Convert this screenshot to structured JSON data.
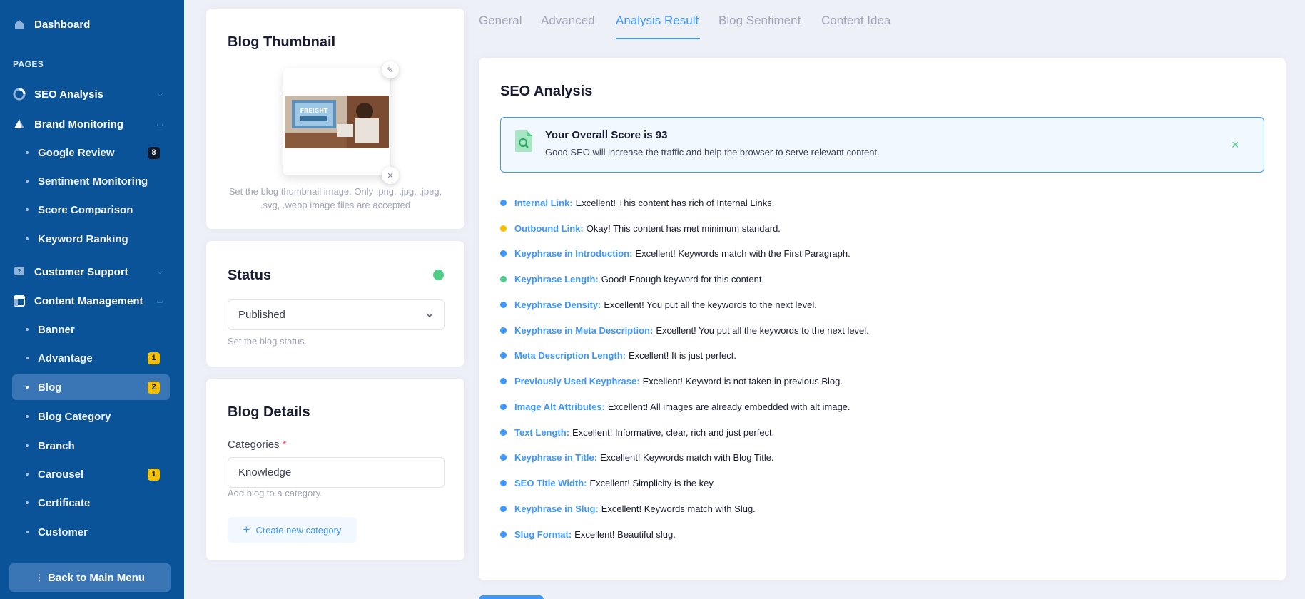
{
  "sidebar": {
    "dashboard": "Dashboard",
    "pages_label": "PAGES",
    "seo_analysis": "SEO Analysis",
    "brand_monitoring": "Brand Monitoring",
    "brand_items": [
      {
        "label": "Google Review",
        "badge": "8"
      },
      {
        "label": "Sentiment Monitoring"
      },
      {
        "label": "Score Comparison"
      },
      {
        "label": "Keyword Ranking"
      }
    ],
    "customer_support": "Customer Support",
    "content_management": "Content Management",
    "content_items": [
      {
        "label": "Banner"
      },
      {
        "label": "Advantage",
        "badge": "1"
      },
      {
        "label": "Blog",
        "badge": "2"
      },
      {
        "label": "Blog Category"
      },
      {
        "label": "Branch"
      },
      {
        "label": "Carousel",
        "badge": "1"
      },
      {
        "label": "Certificate"
      },
      {
        "label": "Customer"
      }
    ],
    "back_button": "Back to Main Menu"
  },
  "thumbnail": {
    "title": "Blog Thumbnail",
    "hint": "Set the blog thumbnail image. Only .png, .jpg, .jpeg, .svg, .webp image files are accepted",
    "image_text": "FREIGHT"
  },
  "status": {
    "title": "Status",
    "value": "Published",
    "hint": "Set the blog status.",
    "indicator_color": "#50cd89"
  },
  "details": {
    "title": "Blog Details",
    "categories_label": "Categories",
    "required_mark": "*",
    "categories_value": "Knowledge",
    "categories_hint": "Add blog to a category.",
    "create_button": "Create new category"
  },
  "tabs": [
    {
      "label": "General"
    },
    {
      "label": "Advanced"
    },
    {
      "label": "Analysis Result",
      "active": true
    },
    {
      "label": "Blog Sentiment"
    },
    {
      "label": "Content Idea"
    }
  ],
  "seo": {
    "title": "SEO Analysis",
    "score_title": "Your Overall Score is 93",
    "score_sub": "Good SEO will increase the traffic and help the browser to serve relevant content.",
    "checks": [
      {
        "key": "Internal Link:",
        "text": "Excellent! This content has rich of Internal Links.",
        "color": "#3e97ff"
      },
      {
        "key": "Outbound Link:",
        "text": "Okay! This content has met minimum standard.",
        "color": "#f6c000"
      },
      {
        "key": "Keyphrase in Introduction:",
        "text": "Excellent! Keywords match with the First Paragraph.",
        "color": "#3e97ff"
      },
      {
        "key": "Keyphrase Length:",
        "text": "Good! Enough keyword for this content.",
        "color": "#50cd89"
      },
      {
        "key": "Keyphrase Density:",
        "text": "Excellent! You put all the keywords to the next level.",
        "color": "#3e97ff"
      },
      {
        "key": "Keyphrase in Meta Description:",
        "text": "Excellent! You put all the keywords to the next level.",
        "color": "#3e97ff"
      },
      {
        "key": "Meta Description Length:",
        "text": "Excellent! It is just perfect.",
        "color": "#3e97ff"
      },
      {
        "key": "Previously Used Keyphrase:",
        "text": "Excellent! Keyword is not taken in previous Blog.",
        "color": "#3e97ff"
      },
      {
        "key": "Image Alt Attributes:",
        "text": "Excellent! All images are already embedded with alt image.",
        "color": "#3e97ff"
      },
      {
        "key": "Text Length:",
        "text": "Excellent! Informative, clear, rich and just perfect.",
        "color": "#3e97ff"
      },
      {
        "key": "Keyphrase in Title:",
        "text": "Excellent! Keywords match with Blog Title.",
        "color": "#3e97ff"
      },
      {
        "key": "SEO Title Width:",
        "text": "Excellent! Simplicity is the key.",
        "color": "#3e97ff"
      },
      {
        "key": "Keyphrase in Slug:",
        "text": "Excellent! Keywords match with Slug.",
        "color": "#3e97ff"
      },
      {
        "key": "Slug Format:",
        "text": "Excellent! Beautiful slug.",
        "color": "#3e97ff"
      }
    ]
  },
  "colors": {
    "sidebar_bg": "#0b5399",
    "accent": "#3e97ff",
    "success": "#50cd89",
    "warning": "#f6c000"
  }
}
